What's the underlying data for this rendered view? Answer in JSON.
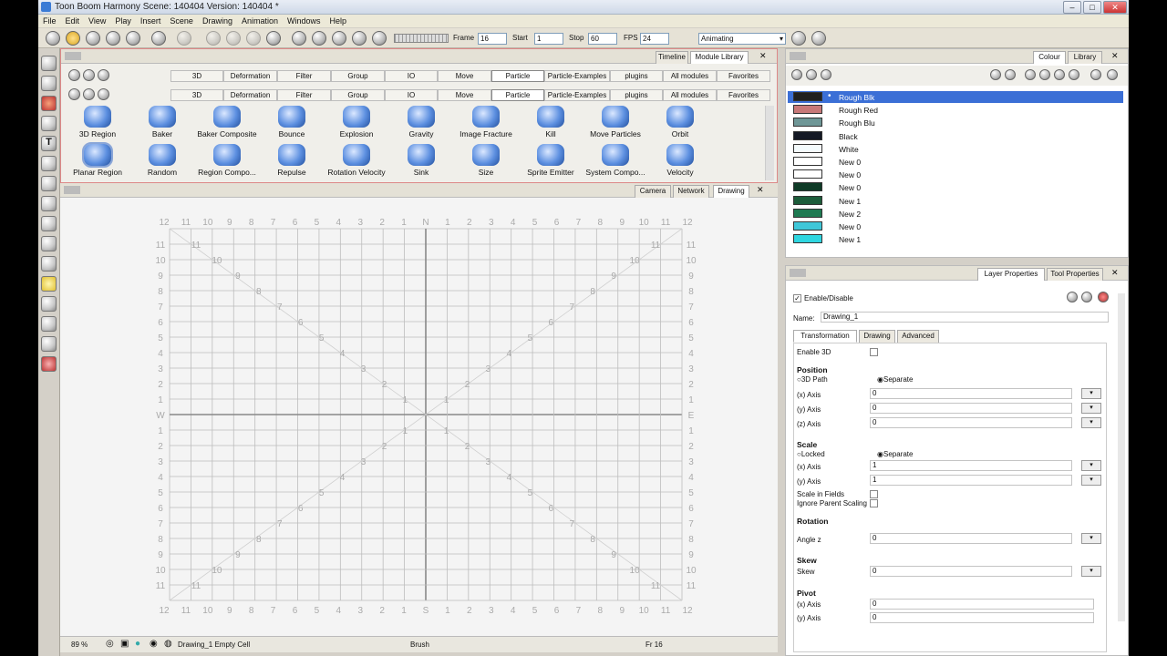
{
  "window": {
    "title": "Toon Boom Harmony Scene: 140404 Version: 140404 *"
  },
  "menu": [
    "File",
    "Edit",
    "View",
    "Play",
    "Insert",
    "Scene",
    "Drawing",
    "Animation",
    "Windows",
    "Help"
  ],
  "playback": {
    "frame_label": "Frame",
    "frame": "16",
    "start_label": "Start",
    "start": "1",
    "stop_label": "Stop",
    "stop": "60",
    "fps_label": "FPS",
    "fps": "24",
    "mode": "Animating"
  },
  "modules_panel": {
    "tabs": [
      "Timeline",
      "Module Library"
    ],
    "categories": [
      "3D",
      "Deformation",
      "Filter",
      "Group",
      "IO",
      "Move",
      "Particle",
      "Particle-Examples",
      "plugins",
      "All modules",
      "Favorites"
    ],
    "active_category": "Particle",
    "modules_row1": [
      "3D Region",
      "Baker",
      "Baker Composite",
      "Bounce",
      "Explosion",
      "Gravity",
      "Image Fracture",
      "Kill",
      "Move Particles",
      "Orbit"
    ],
    "modules_row2": [
      "Planar Region",
      "Random",
      "Region Compo...",
      "Repulse",
      "Rotation Velocity",
      "Sink",
      "Size",
      "Sprite Emitter",
      "System Compo...",
      "Velocity"
    ]
  },
  "view_tabs": [
    "Camera",
    "Network",
    "Drawing"
  ],
  "field_chart": {
    "top_labels": [
      "12",
      "11",
      "10",
      "9",
      "8",
      "7",
      "6",
      "5",
      "4",
      "3",
      "2",
      "1",
      "N",
      "1",
      "2",
      "3",
      "4",
      "5",
      "6",
      "7",
      "8",
      "9",
      "10",
      "11",
      "12"
    ],
    "bottom_labels": [
      "12",
      "11",
      "10",
      "9",
      "8",
      "7",
      "6",
      "5",
      "4",
      "3",
      "2",
      "1",
      "S",
      "1",
      "2",
      "3",
      "4",
      "5",
      "6",
      "7",
      "8",
      "9",
      "10",
      "11",
      "12"
    ],
    "left_labels": [
      "11",
      "10",
      "9",
      "8",
      "7",
      "6",
      "5",
      "4",
      "3",
      "2",
      "1",
      "W",
      "1",
      "2",
      "3",
      "4",
      "5",
      "6",
      "7",
      "8",
      "9",
      "10",
      "11"
    ],
    "right_labels": [
      "11",
      "10",
      "9",
      "8",
      "7",
      "6",
      "5",
      "4",
      "3",
      "2",
      "1",
      "E",
      "1",
      "2",
      "3",
      "4",
      "5",
      "6",
      "7",
      "8",
      "9",
      "10",
      "11"
    ],
    "diag_labels": [
      "11",
      "10",
      "9",
      "8",
      "7",
      "6",
      "5",
      "4",
      "3",
      "2",
      "1"
    ]
  },
  "status": {
    "zoom": "89 %",
    "cell": "Drawing_1 Empty Cell",
    "tool": "Brush",
    "frame": "Fr 16"
  },
  "colour_panel": {
    "tabs": [
      "Colour",
      "Library"
    ],
    "colours": [
      {
        "name": "Rough Blk",
        "hex": "#202020",
        "selected": true
      },
      {
        "name": "Rough Red",
        "hex": "#c87878"
      },
      {
        "name": "Rough Blu",
        "hex": "#6e9696"
      },
      {
        "name": "Black",
        "hex": "#141824"
      },
      {
        "name": "White",
        "hex": "#f4fbfd"
      },
      {
        "name": "New 0",
        "hex": "#ffffff"
      },
      {
        "name": "New 0",
        "hex": "#ffffff"
      },
      {
        "name": "New 0",
        "hex": "#0f3b27"
      },
      {
        "name": "New 1",
        "hex": "#1d5c3a"
      },
      {
        "name": "New 2",
        "hex": "#1f7a52"
      },
      {
        "name": "New 0",
        "hex": "#3fc7d8"
      },
      {
        "name": "New 1",
        "hex": "#2fd6e0"
      }
    ]
  },
  "props_panel": {
    "tabs": [
      "Layer Properties",
      "Tool Properties"
    ],
    "enable_label": "Enable/Disable",
    "name_label": "Name:",
    "name_value": "Drawing_1",
    "subtabs": [
      "Transformation",
      "Drawing",
      "Advanced"
    ],
    "enable3d": "Enable 3D",
    "position": {
      "title": "Position",
      "opt1": "3D Path",
      "opt2": "Separate",
      "x_label": "(x) Axis",
      "x": "0",
      "y_label": "(y) Axis",
      "y": "0",
      "z_label": "(z) Axis",
      "z": "0"
    },
    "scale": {
      "title": "Scale",
      "opt1": "Locked",
      "opt2": "Separate",
      "x_label": "(x) Axis",
      "x": "1",
      "y_label": "(y) Axis",
      "y": "1",
      "fields_label": "Scale in Fields",
      "ignore_label": "Ignore Parent Scaling"
    },
    "rotation": {
      "title": "Rotation",
      "angle_label": "Angle z",
      "angle": "0"
    },
    "skew": {
      "title": "Skew",
      "skew_label": "Skew",
      "skew": "0"
    },
    "pivot": {
      "title": "Pivot",
      "x_label": "(x) Axis",
      "x": "0",
      "y_label": "(y) Axis",
      "y": "0"
    }
  }
}
